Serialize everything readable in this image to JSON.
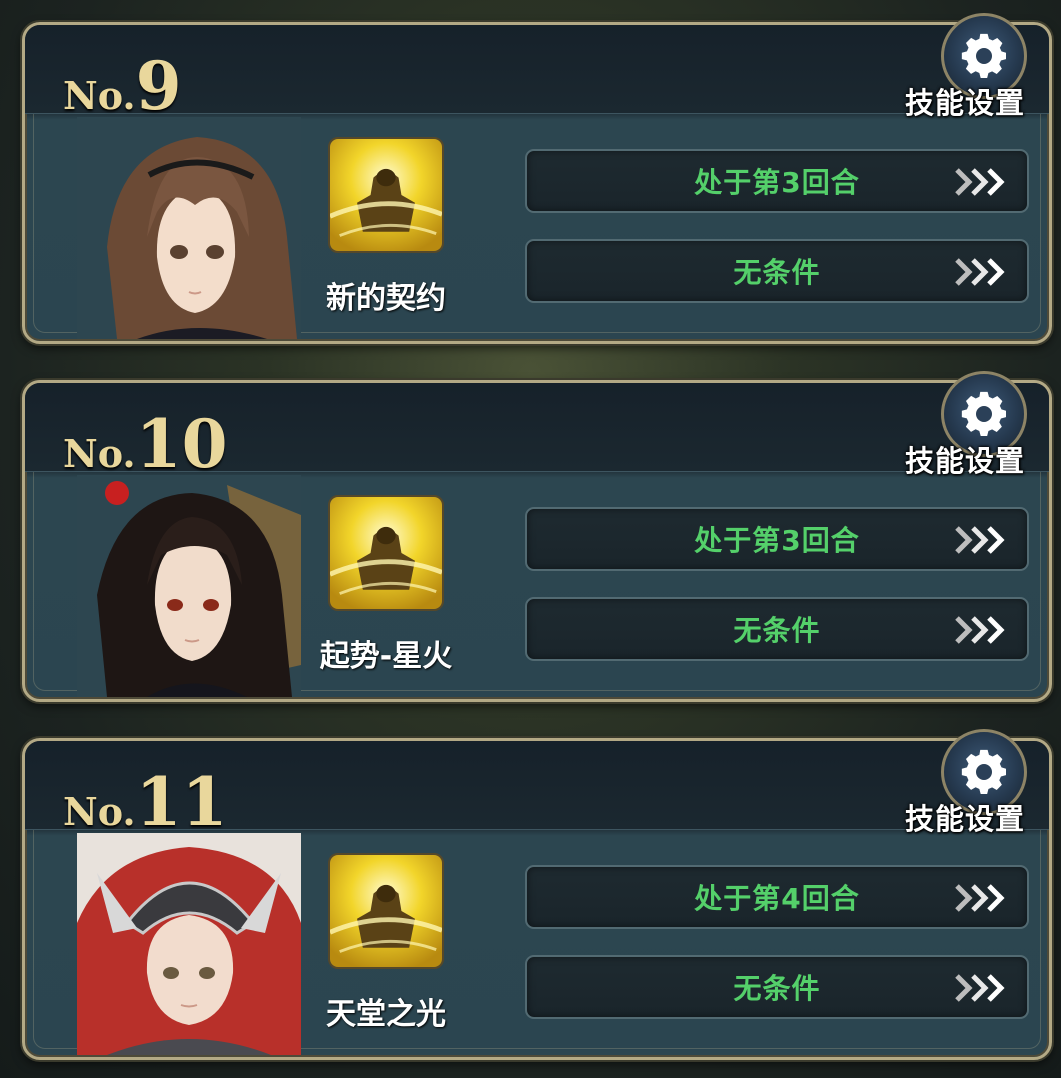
{
  "gear_label": "技能设置",
  "cards": [
    {
      "no_prefix": "No.",
      "number": "9",
      "skill_name": "新的契约",
      "conditions": [
        "处于第3回合",
        "无条件"
      ]
    },
    {
      "no_prefix": "No.",
      "number": "10",
      "skill_name": "起势-星火",
      "conditions": [
        "处于第3回合",
        "无条件"
      ]
    },
    {
      "no_prefix": "No.",
      "number": "11",
      "skill_name": "天堂之光",
      "conditions": [
        "处于第4回合",
        "无条件"
      ]
    }
  ],
  "icons": {
    "gear": "gear-icon",
    "arrows": "triple-chevron-right-icon",
    "skill": "golden-warrior-skill-icon"
  },
  "colors": {
    "condition_text": "#54d06a",
    "number_gold": "#e9d79c",
    "frame": "#b3a985"
  }
}
